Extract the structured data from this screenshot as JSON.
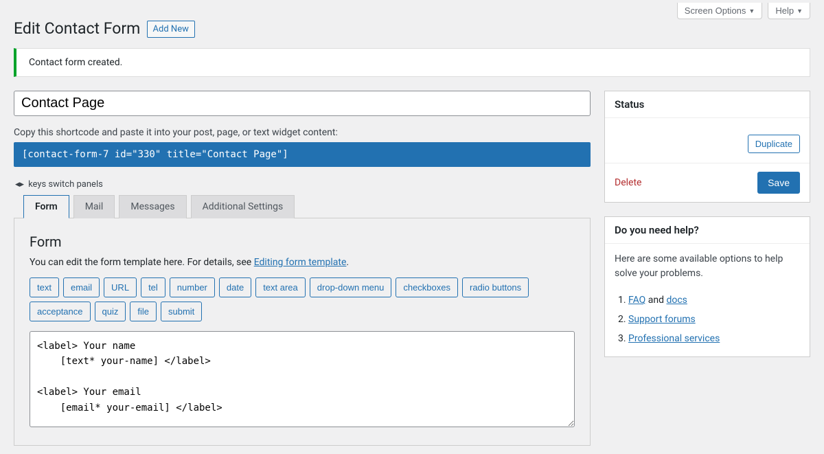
{
  "topButtons": {
    "screenOptions": "Screen Options",
    "help": "Help"
  },
  "pageTitle": "Edit Contact Form",
  "addNew": "Add New",
  "notice": "Contact form created.",
  "formTitle": "Contact Page",
  "shortcodeLabel": "Copy this shortcode and paste it into your post, page, or text widget content:",
  "shortcode": "[contact-form-7 id=\"330\" title=\"Contact Page\"]",
  "keysHint": "keys switch panels",
  "tabs": {
    "form": "Form",
    "mail": "Mail",
    "messages": "Messages",
    "additional": "Additional Settings"
  },
  "formPanel": {
    "heading": "Form",
    "descPrefix": "You can edit the form template here. For details, see ",
    "descLink": "Editing form template",
    "descSuffix": ".",
    "tagButtons": [
      "text",
      "email",
      "URL",
      "tel",
      "number",
      "date",
      "text area",
      "drop-down menu",
      "checkboxes",
      "radio buttons",
      "acceptance",
      "quiz",
      "file",
      "submit"
    ],
    "template": "<label> Your name\n    [text* your-name] </label>\n\n<label> Your email\n    [email* your-email] </label>"
  },
  "statusBox": {
    "title": "Status",
    "duplicate": "Duplicate",
    "delete": "Delete",
    "save": "Save"
  },
  "helpBox": {
    "title": "Do you need help?",
    "intro": "Here are some available options to help solve your problems.",
    "andText": " and ",
    "items": {
      "faq": "FAQ",
      "docs": "docs",
      "forums": "Support forums",
      "pro": "Professional services"
    }
  }
}
